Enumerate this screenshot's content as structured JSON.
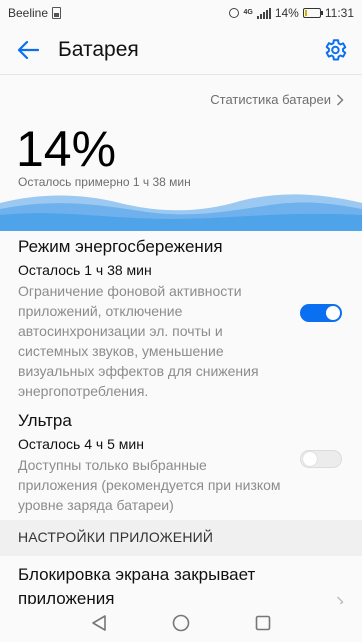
{
  "status_bar": {
    "carrier": "Beeline",
    "network": "4G",
    "battery_percent": "14%",
    "battery_level": 0.14,
    "time": "11:31"
  },
  "toolbar": {
    "title": "Батарея",
    "back_icon": "arrow-left-icon",
    "settings_icon": "gear-icon"
  },
  "battery": {
    "stats_link": "Статистика батареи",
    "percent": "14%",
    "remaining": "Осталось примерно 1 ч 38 мин"
  },
  "power_saving": {
    "title": "Режим энергосбережения",
    "remaining": "Осталось 1 ч 38 мин",
    "description": "Ограничение фоновой активности приложений, отключение автосинхронизации эл. почты и системных звуков, уменьшение визуальных эффектов для снижения энергопотребления.",
    "enabled": true
  },
  "ultra": {
    "title": "Ультра",
    "remaining": "Осталось 4 ч 5 мин",
    "description": "Доступны только выбранные приложения (рекомендуется при низком уровне заряда батареи)",
    "enabled": false
  },
  "app_settings": {
    "header": "НАСТРОЙКИ ПРИЛОЖЕНИЙ",
    "lock_item": "Блокировка экрана закрывает приложения"
  },
  "colors": {
    "accent": "#0a6ff0",
    "wave": "#4fa3e8"
  }
}
